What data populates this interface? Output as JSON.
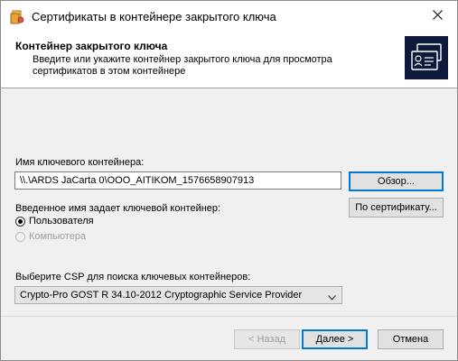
{
  "window": {
    "title": "Сертификаты в контейнере закрытого ключа"
  },
  "header": {
    "title": "Контейнер закрытого ключа",
    "description": "Введите или укажите контейнер закрытого ключа для просмотра сертификатов в этом контейнере"
  },
  "container": {
    "label": "Имя ключевого контейнера:",
    "value": "\\\\.\\ARDS JaCarta 0\\OOO_AITIKOM_1576658907913",
    "browse_label": "Обзор..."
  },
  "lookup": {
    "label": "Введенное имя задает ключевой контейнер:",
    "by_cert_label": "По сертификату...",
    "options": [
      {
        "label": "Пользователя",
        "checked": true,
        "enabled": true
      },
      {
        "label": "Компьютера",
        "checked": false,
        "enabled": false
      }
    ]
  },
  "csp": {
    "label": "Выберите CSP для поиска ключевых контейнеров:",
    "selected": "Crypto-Pro GOST R 34.10-2012 Cryptographic Service Provider"
  },
  "footer": {
    "back_label": "< Назад",
    "next_label": "Далее >",
    "cancel_label": "Отмена"
  },
  "icons": {
    "app": "certificate-app-icon",
    "close": "close-icon",
    "header": "certificate-card-icon",
    "dropdown": "chevron-down-icon"
  },
  "colors": {
    "accent": "#0078d7",
    "header_art_bg": "#0e1a3a"
  }
}
